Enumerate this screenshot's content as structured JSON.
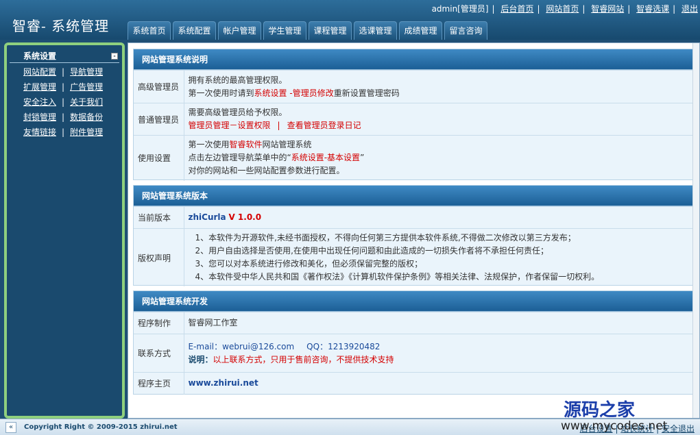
{
  "header": {
    "brand": "智睿- 系统管理",
    "user": "admin[管理员]",
    "links": [
      "后台首页",
      "网站首页",
      "智睿网站",
      "智睿选课",
      "退出"
    ],
    "tabs": [
      "系统首页",
      "系统配置",
      "帐户管理",
      "学生管理",
      "课程管理",
      "选课管理",
      "成绩管理",
      "留言咨询"
    ]
  },
  "sidebar": {
    "title": "系统设置",
    "collapse_symbol": "-",
    "rows": [
      [
        "网站配置",
        "导航管理"
      ],
      [
        "扩展管理",
        "广告管理"
      ],
      [
        "安全注入",
        "关于我们"
      ],
      [
        "封锁管理",
        "数据备份"
      ],
      [
        "友情链接",
        "附件管理"
      ]
    ]
  },
  "sections": {
    "intro": {
      "title": "网站管理系统说明",
      "rows": {
        "admin": {
          "label": "高级管理员",
          "line1": "拥有系统的最高管理权限。",
          "line2_prefix": "第一次使用时请到",
          "line2_link1": "系统设置",
          "line2_dash": " -",
          "line2_link2": "管理员修改",
          "line2_suffix": "重新设置管理密码"
        },
        "normal": {
          "label": "普通管理员",
          "line1": "需要高级管理员给予权限。",
          "link1": "管理员管理－设置权限",
          "sep": "|",
          "link2": "查看管理员登录日记"
        },
        "usage": {
          "label": "使用设置",
          "line1_prefix": "第一次使用",
          "line1_highlight": "智睿软件",
          "line1_suffix": "网站管理系统",
          "line2_prefix": "点击左边管理导航菜单中的“",
          "line2_highlight": "系统设置-基本设置",
          "line2_suffix": "”",
          "line3": "对你的网站和一些网站配置参数进行配置。"
        }
      }
    },
    "version": {
      "title": "网站管理系统版本",
      "current_label": "当前版本",
      "product": "zhiCurla",
      "version": "V 1.0.0",
      "copyright_label": "版权声明",
      "terms": [
        "1、本软件为开源软件,未经书面授权，不得向任何第三方提供本软件系统,不得做二次修改以第三方发布；",
        "2、用户自由选择是否使用,在使用中出现任何问题和由此造成的一切损失作者将不承担任何责任；",
        "3、您可以对本系统进行修改和美化，但必须保留完整的版权；",
        "4、本软件受中华人民共和国《著作权法》《计算机软件保护条例》等相关法律、法规保护，作者保留一切权利。"
      ]
    },
    "dev": {
      "title": "网站管理系统开发",
      "maker_label": "程序制作",
      "maker": "智睿网工作室",
      "contact_label": "联系方式",
      "email_label": "E-mail：",
      "email": "webrui@126.com",
      "qq_label": "QQ：",
      "qq": "1213920482",
      "note_label": "说明：",
      "note": "以上联系方式，只用于售前咨询，不提供技术支持",
      "home_label": "程序主页",
      "home": "www.zhirui.net"
    }
  },
  "footer": {
    "toggle": "«",
    "copyright": "Copyright Right © 2009-2015 zhirui.net",
    "links": [
      "后台设置",
      "站长统计",
      "安全退出"
    ]
  },
  "watermark": {
    "title": "源码之家",
    "url": "www.mycodes.net"
  }
}
